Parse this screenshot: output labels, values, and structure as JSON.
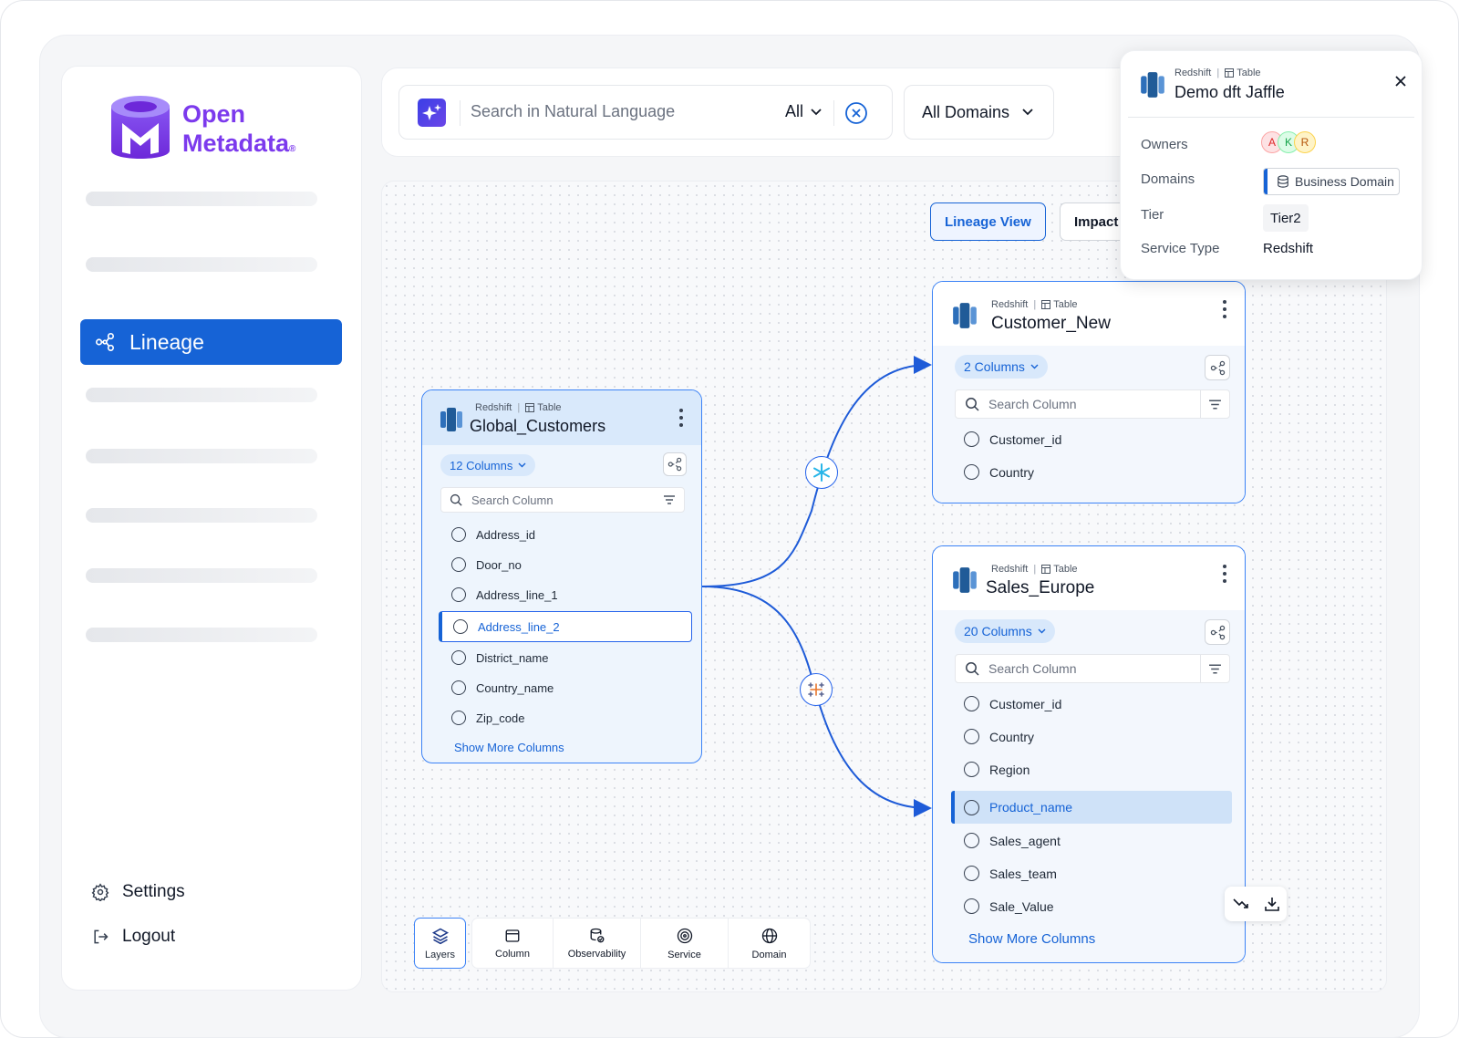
{
  "brand": {
    "line1": "Open",
    "line2": "Metadata",
    "reg": "®"
  },
  "sidebar": {
    "active_label": "Lineage",
    "settings_label": "Settings",
    "logout_label": "Logout"
  },
  "search": {
    "placeholder": "Search in Natural Language",
    "scope": "All",
    "domain_select": "All Domains"
  },
  "view_tabs": {
    "lineage": "Lineage View",
    "impact": "Impact"
  },
  "popup": {
    "service": "Redshift",
    "entity_type": "Table",
    "title": "Demo dft Jaffle",
    "owners_label": "Owners",
    "owners": [
      "A",
      "K",
      "R"
    ],
    "domains_label": "Domains",
    "domain": "Business Domain",
    "tier_label": "Tier",
    "tier": "Tier2",
    "service_type_label": "Service Type",
    "service_type": "Redshift"
  },
  "nodes": {
    "global": {
      "service": "Redshift",
      "entity_type": "Table",
      "title": "Global_Customers",
      "columns_pill": "12 Columns",
      "search_placeholder": "Search Column",
      "columns": [
        "Address_id",
        "Door_no",
        "Address_line_1",
        "Address_line_2",
        "District_name",
        "Country_name",
        "Zip_code"
      ],
      "selected_column": "Address_line_2",
      "show_more": "Show More Columns"
    },
    "customer_new": {
      "service": "Redshift",
      "entity_type": "Table",
      "title": "Customer_New",
      "columns_pill": "2 Columns",
      "search_placeholder": "Search Column",
      "columns": [
        "Customer_id",
        "Country"
      ]
    },
    "sales_europe": {
      "service": "Redshift",
      "entity_type": "Table",
      "title": "Sales_Europe",
      "columns_pill": "20 Columns",
      "search_placeholder": "Search Column",
      "columns": [
        "Customer_id",
        "Country",
        "Region",
        "Product_name",
        "Sales_agent",
        "Sales_team",
        "Sale_Value"
      ],
      "selected_column": "Product_name",
      "show_more": "Show More Columns"
    }
  },
  "toolbar": {
    "layers": "Layers",
    "column": "Column",
    "observability": "Observability",
    "service": "Service",
    "domain": "Domain"
  },
  "colors": {
    "primary": "#1663d6",
    "brand": "#7c3aed",
    "edge": "#2563eb",
    "node_bg": "#eef5fd"
  }
}
